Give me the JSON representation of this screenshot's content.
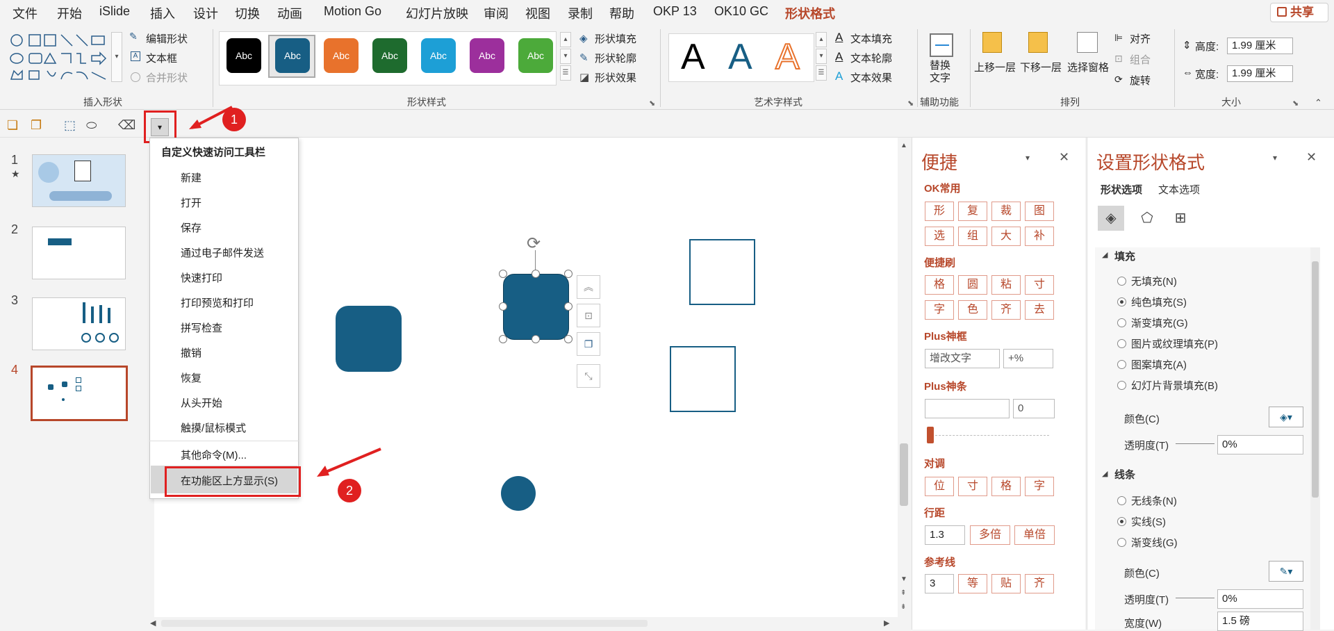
{
  "tabs": [
    "文件",
    "开始",
    "iSlide",
    "插入",
    "设计",
    "切换",
    "动画",
    "Motion Go",
    "幻灯片放映",
    "审阅",
    "视图",
    "录制",
    "帮助",
    "OKP 13",
    "OK10 GC",
    "形状格式"
  ],
  "share": "共享",
  "ribbon": {
    "insert_shape": {
      "edit_shape": "编辑形状",
      "textbox": "文本框",
      "merge": "合并形状",
      "label": "插入形状"
    },
    "shape_styles": {
      "swatches": [
        {
          "text": "Abc",
          "color": "#000000"
        },
        {
          "text": "Abc",
          "color": "#175e84"
        },
        {
          "text": "Abc",
          "color": "#e8722c"
        },
        {
          "text": "Abc",
          "color": "#1e6b2e"
        },
        {
          "text": "Abc",
          "color": "#1d9fd6"
        },
        {
          "text": "Abc",
          "color": "#9c2f9c"
        },
        {
          "text": "Abc",
          "color": "#4caa3a"
        }
      ],
      "fill": "形状填充",
      "outline": "形状轮廓",
      "effect": "形状效果",
      "label": "形状样式"
    },
    "wordart": {
      "letters": [
        "A",
        "A",
        "A"
      ],
      "text_fill": "文本填充",
      "text_outline": "文本轮廓",
      "text_effect": "文本效果",
      "label": "艺术字样式"
    },
    "accessibility": {
      "alt_text": "替换\n文字",
      "label": "辅助功能"
    },
    "arrange": {
      "bring_forward": "上移一层",
      "send_backward": "下移一层",
      "selection_pane": "选择窗格",
      "align": "对齐",
      "group": "组合",
      "rotate": "旋转",
      "label": "排列"
    },
    "size": {
      "height_label": "高度:",
      "height": "1.99 厘米",
      "width_label": "宽度:",
      "width": "1.99 厘米",
      "label": "大小"
    }
  },
  "menu": {
    "title": "自定义快速访问工具栏",
    "items": [
      "新建",
      "打开",
      "保存",
      "通过电子邮件发送",
      "快速打印",
      "打印预览和打印",
      "拼写检查",
      "撤销",
      "恢复",
      "从头开始",
      "触摸/鼠标模式"
    ],
    "more": "其他命令(M)...",
    "show_above": "在功能区上方显示(S)"
  },
  "thumbnails": [
    "1",
    "2",
    "3",
    "4"
  ],
  "badges": [
    "1",
    "2"
  ],
  "panel1": {
    "title": "便捷",
    "sec_ok": "OK常用",
    "ok_buttons": [
      "形",
      "复",
      "裁",
      "图",
      "选",
      "组",
      "大",
      "补"
    ],
    "sec_brush": "便捷刷",
    "brush_buttons": [
      "格",
      "圆",
      "粘",
      "寸",
      "字",
      "色",
      "齐",
      "去"
    ],
    "sec_frame": "Plus神框",
    "frame_input": "增改文字",
    "frame_pct": "+%",
    "sec_bar": "Plus神条",
    "bar_value": "0",
    "sec_adjust": "对调",
    "adjust_buttons": [
      "位",
      "寸",
      "格",
      "字"
    ],
    "sec_spacing": "行距",
    "spacing_value": "1.3",
    "spacing_buttons": [
      "多倍",
      "单倍"
    ],
    "sec_guides": "参考线",
    "guide_value": "3",
    "guide_buttons": [
      "等",
      "贴",
      "齐"
    ]
  },
  "panel2": {
    "title": "设置形状格式",
    "tab_shape": "形状选项",
    "tab_text": "文本选项",
    "sec_fill": "填充",
    "fill_options": [
      "无填充(N)",
      "纯色填充(S)",
      "渐变填充(G)",
      "图片或纹理填充(P)",
      "图案填充(A)",
      "幻灯片背景填充(B)"
    ],
    "fill_selected": 1,
    "color_label": "颜色(C)",
    "transparency_label": "透明度(T)",
    "transparency": "0%",
    "sec_line": "线条",
    "line_options": [
      "无线条(N)",
      "实线(S)",
      "渐变线(G)"
    ],
    "line_selected": 1,
    "line_color_label": "颜色(C)",
    "line_transparency_label": "透明度(T)",
    "line_transparency": "0%",
    "width_label": "宽度(W)",
    "width_value": "1.5 磅"
  }
}
